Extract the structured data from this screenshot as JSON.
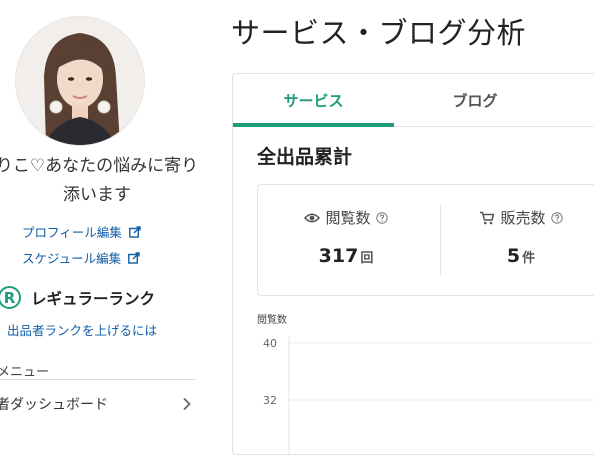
{
  "profile": {
    "name": "りこ♡あなたの悩みに寄り添います",
    "edit_profile_label": "プロフィール編集",
    "edit_schedule_label": "スケジュール編集"
  },
  "rank": {
    "badge_letter": "R",
    "label": "レギュラーランク",
    "upgrade_link": "出品者ランクを上げるには"
  },
  "menu": {
    "heading": "メニュー",
    "items": [
      {
        "label": "者ダッシュボード"
      }
    ]
  },
  "page": {
    "title": "サービス・ブログ分析"
  },
  "tabs": [
    {
      "label": "サービス",
      "active": true
    },
    {
      "label": "ブログ",
      "active": false
    }
  ],
  "summary": {
    "title": "全出品累計",
    "stats": [
      {
        "label": "閲覧数",
        "value": "317",
        "unit": "回",
        "icon": "eye-icon"
      },
      {
        "label": "販売数",
        "value": "5",
        "unit": "件",
        "icon": "cart-icon"
      }
    ]
  },
  "colors": {
    "accent": "#1e9d7c",
    "link": "#0f5ca8"
  },
  "chart_data": {
    "type": "line",
    "ylabel": "閲覧数",
    "y_ticks": [
      40,
      32
    ],
    "series": []
  }
}
